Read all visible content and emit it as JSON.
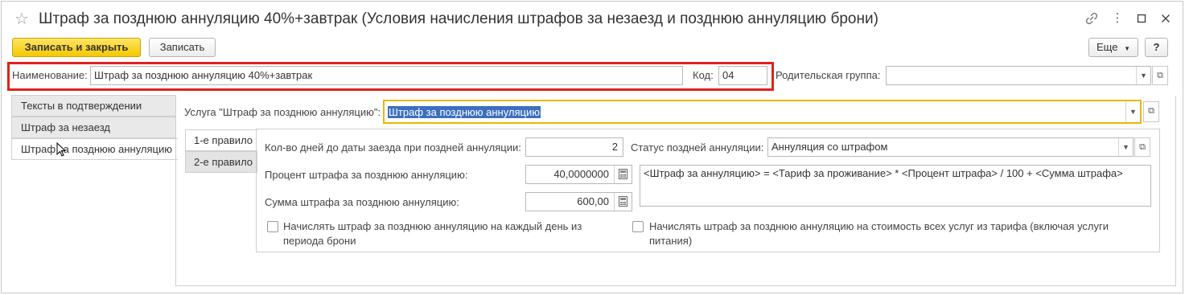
{
  "window": {
    "title": "Штраф за позднюю аннуляцию 40%+завтрак (Условия начисления штрафов за незаезд и позднюю аннуляцию брони)"
  },
  "toolbar": {
    "save_close_label": "Записать и закрыть",
    "save_label": "Записать",
    "more_label": "Еще",
    "help_label": "?"
  },
  "header": {
    "name_label": "Наименование:",
    "name_value": "Штраф за позднюю аннуляцию 40%+завтрак",
    "code_label": "Код:",
    "code_value": "04",
    "parent_label": "Родительская группа:",
    "parent_value": ""
  },
  "side_tabs": [
    {
      "label": "Тексты в подтверждении"
    },
    {
      "label": "Штраф за незаезд"
    },
    {
      "label": "Штраф за позднюю аннуляцию"
    }
  ],
  "service": {
    "label": "Услуга \"Штраф за позднюю аннуляцию\":",
    "value": "Штраф за позднюю аннуляцию"
  },
  "rule_tabs": [
    {
      "label": "1-е правило"
    },
    {
      "label": "2-е правило"
    }
  ],
  "rule": {
    "days_label": "Кол-во дней до даты заезда при поздней аннуляции:",
    "days_value": "2",
    "percent_label": "Процент штрафа за позднюю аннуляцию:",
    "percent_value": "40,0000000",
    "sum_label": "Сумма штрафа за позднюю аннуляцию:",
    "sum_value": "600,00",
    "status_label": "Статус поздней аннуляции:",
    "status_value": "Аннуляция со штрафом",
    "formula": "<Штраф за аннуляцию> = <Тариф за проживание> * <Процент штрафа> / 100 + <Сумма штрафа>",
    "checkbox_per_day": "Начислять штраф за позднюю аннуляцию на каждый день из периода брони",
    "checkbox_all_services": "Начислять штраф за позднюю аннуляцию на стоимость всех услуг из тарифа (включая услуги питания)"
  },
  "colors": {
    "primary_button": "#f4c800",
    "highlight_frame": "#e32020",
    "focus_border": "#e8b800",
    "selection": "#3d6fbf"
  }
}
